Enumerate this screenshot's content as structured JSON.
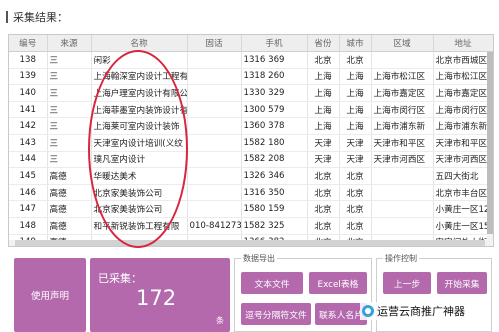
{
  "result_title": "采集结果：",
  "table": {
    "headers": [
      "编号",
      "来源",
      "名称",
      "固话",
      "手机",
      "省份",
      "城市",
      "区域",
      "地址"
    ],
    "rows": [
      {
        "id": "138",
        "source": "三",
        "name": "闲彩",
        "tel": "",
        "mobile": "1316 369",
        "province": "北京",
        "city": "北京",
        "district": "",
        "address": "北京市西城区"
      },
      {
        "id": "139",
        "source": "三",
        "name": "上海翰深室内设计工程有",
        "tel": "",
        "mobile": "1318 260",
        "province": "上海",
        "city": "上海",
        "district": "上海市松江区",
        "address": "上海市松江区"
      },
      {
        "id": "140",
        "source": "三",
        "name": "上海户理室内设计有限公",
        "tel": "",
        "mobile": "1330 329",
        "province": "上海",
        "city": "上海",
        "district": "上海市嘉定区",
        "address": "上海市嘉定区"
      },
      {
        "id": "141",
        "source": "三",
        "name": "上海菲墨室内装饰设计有",
        "tel": "",
        "mobile": "1300 579",
        "province": "上海",
        "city": "上海",
        "district": "上海市闵行区",
        "address": "上海市闵行区"
      },
      {
        "id": "142",
        "source": "三",
        "name": "上海莱可室内设计装饰",
        "tel": "",
        "mobile": "1360 378",
        "province": "上海",
        "city": "上海",
        "district": "上海市浦东新",
        "address": "上海市浦东新"
      },
      {
        "id": "143",
        "source": "三",
        "name": "天津室内设计培训(义纹",
        "tel": "",
        "mobile": "1582 180",
        "province": "天津",
        "city": "天津",
        "district": "天津市和平区",
        "address": "天津市和平区"
      },
      {
        "id": "144",
        "source": "三",
        "name": "璞凡室内设计",
        "tel": "",
        "mobile": "1582 208",
        "province": "天津",
        "city": "天津",
        "district": "天津市河西区",
        "address": "天津市河西区"
      },
      {
        "id": "145",
        "source": "高德",
        "name": "华暖达美术",
        "tel": "",
        "mobile": "1326 346",
        "province": "北京",
        "city": "北京",
        "district": "",
        "address": "五四大街北"
      },
      {
        "id": "146",
        "source": "高德",
        "name": "北京家美装饰公司",
        "tel": "",
        "mobile": "1316 350",
        "province": "北京",
        "city": "北京",
        "district": "",
        "address": "北京市丰台区"
      },
      {
        "id": "147",
        "source": "高德",
        "name": "北京家美装饰公司",
        "tel": "",
        "mobile": "1580 159",
        "province": "北京",
        "city": "北京",
        "district": "",
        "address": "小黄庄一区12"
      },
      {
        "id": "148",
        "source": "高德",
        "name": "和平新锐装饰工程有限",
        "tel": "010-84127384",
        "mobile": "1582 325",
        "province": "北京",
        "city": "北京",
        "district": "",
        "address": "小黄庄一区15"
      },
      {
        "id": "149",
        "source": "高德",
        "name": "",
        "tel": "",
        "mobile": "1366 382",
        "province": "北京",
        "city": "北京",
        "district": "",
        "address": "安定门外大街"
      }
    ]
  },
  "bottom": {
    "help_label": "使用声明",
    "collected_label": "已采集：",
    "collected_count": "172",
    "collected_unit": "条",
    "export_legend": "数据导出",
    "export_buttons": {
      "text_file": "文本文件",
      "excel": "Excel表格",
      "comma_file": "逗号分隔符文件",
      "contact_card": "联系人名片"
    },
    "ops_legend": "操作控制",
    "ops_buttons": {
      "prev": "上一步",
      "start": "开始采集"
    }
  },
  "watermark": "运营云商推广神器",
  "colors": {
    "accent": "#b469ad",
    "annotation": "#d7263d"
  }
}
